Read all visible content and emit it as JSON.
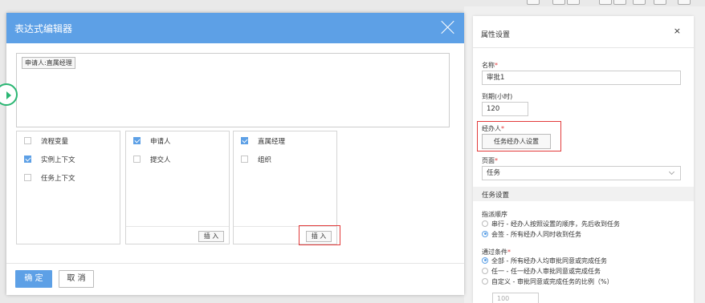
{
  "dialog": {
    "title": "表达式编辑器",
    "expression_tag": "申请人:直属经理",
    "panels": [
      {
        "items": [
          {
            "label": "流程变量",
            "checked": false
          },
          {
            "label": "实例上下文",
            "checked": true
          },
          {
            "label": "任务上下文",
            "checked": false
          }
        ]
      },
      {
        "items": [
          {
            "label": "申请人",
            "checked": true
          },
          {
            "label": "提交人",
            "checked": false
          }
        ],
        "insert_label": "插 入"
      },
      {
        "items": [
          {
            "label": "直属经理",
            "checked": true
          },
          {
            "label": "组织",
            "checked": false
          }
        ],
        "insert_label": "插 入"
      }
    ],
    "ok_label": "确 定",
    "cancel_label": "取 消"
  },
  "props": {
    "title": "属性设置",
    "close": "×",
    "name_label": "名称",
    "name_value": "审批1",
    "due_label": "到期(小时)",
    "due_value": "120",
    "handler_label": "经办人",
    "handler_button": "任务经办人设置",
    "page_label": "页面",
    "page_value": "任务",
    "task_settings": "任务设置",
    "dispatch_label": "指派顺序",
    "dispatch_options": [
      {
        "label": "串行 - 经办人按照设置的顺序，先后收到任务",
        "selected": false
      },
      {
        "label": "会签 - 所有经办人同时收到任务",
        "selected": true
      }
    ],
    "pass_label": "通过条件",
    "pass_options": [
      {
        "label": "全部 - 所有经办人均审批同意或完成任务",
        "selected": true
      },
      {
        "label": "任一 - 任一经办人审批同意或完成任务",
        "selected": false
      },
      {
        "label": "自定义 - 审批同意或完成任务的比例（%）",
        "selected": false
      }
    ],
    "percent_value": "100",
    "required_mark": "*"
  }
}
